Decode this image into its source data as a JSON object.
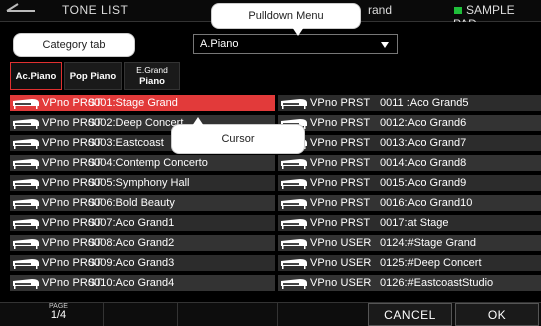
{
  "header": {
    "title": "TONE LIST",
    "tone_name_fragment": "rand",
    "sample_pad": "SAMPLE PAD",
    "accent_color": "#1fbf3a"
  },
  "category": {
    "dropdown_value": "A.Piano",
    "tabs": [
      {
        "label": "Ac.Piano",
        "active": true
      },
      {
        "label": "Pop Piano",
        "active": false
      },
      {
        "label_line1": "E.Grand",
        "label_line2": "Piano",
        "active": false
      }
    ]
  },
  "callouts": {
    "pulldown": "Pulldown Menu",
    "category_tab": "Category tab",
    "cursor": "Cursor"
  },
  "list": {
    "selected_color": "#e23a3a",
    "left": [
      {
        "cat": "VPno PRST",
        "num": "0001:Stage Grand",
        "selected": true
      },
      {
        "cat": "VPno PRST",
        "num": "0002:Deep Concert"
      },
      {
        "cat": "VPno PRST",
        "num": "0003:Eastcoast"
      },
      {
        "cat": "VPno PRST",
        "num": "0004:Contemp Concerto"
      },
      {
        "cat": "VPno PRST",
        "num": "0005:Symphony Hall"
      },
      {
        "cat": "VPno PRST",
        "num": "0006:Bold Beauty"
      },
      {
        "cat": "VPno PRST",
        "num": "0007:Aco Grand1"
      },
      {
        "cat": "VPno PRST",
        "num": "0008:Aco Grand2"
      },
      {
        "cat": "VPno PRST",
        "num": "0009:Aco Grand3"
      },
      {
        "cat": "VPno PRST",
        "num": "0010:Aco Grand4"
      }
    ],
    "right": [
      {
        "cat": "VPno PRST",
        "num": "0011 :Aco Grand5"
      },
      {
        "cat": "VPno PRST",
        "num": "0012:Aco Grand6"
      },
      {
        "cat": "VPno PRST",
        "num": "0013:Aco Grand7"
      },
      {
        "cat": "VPno PRST",
        "num": "0014:Aco Grand8"
      },
      {
        "cat": "VPno PRST",
        "num": "0015:Aco Grand9"
      },
      {
        "cat": "VPno PRST",
        "num": "0016:Aco Grand10"
      },
      {
        "cat": "VPno PRST",
        "num": "0017:at Stage"
      },
      {
        "cat": "VPno USER",
        "num": "0124:#Stage Grand"
      },
      {
        "cat": "VPno USER",
        "num": "0125:#Deep Concert"
      },
      {
        "cat": "VPno USER",
        "num": "0126:#EastcoastStudio"
      }
    ]
  },
  "footer": {
    "page_label": "PAGE",
    "page_value": "1/4",
    "cancel": "CANCEL",
    "ok": "OK"
  }
}
